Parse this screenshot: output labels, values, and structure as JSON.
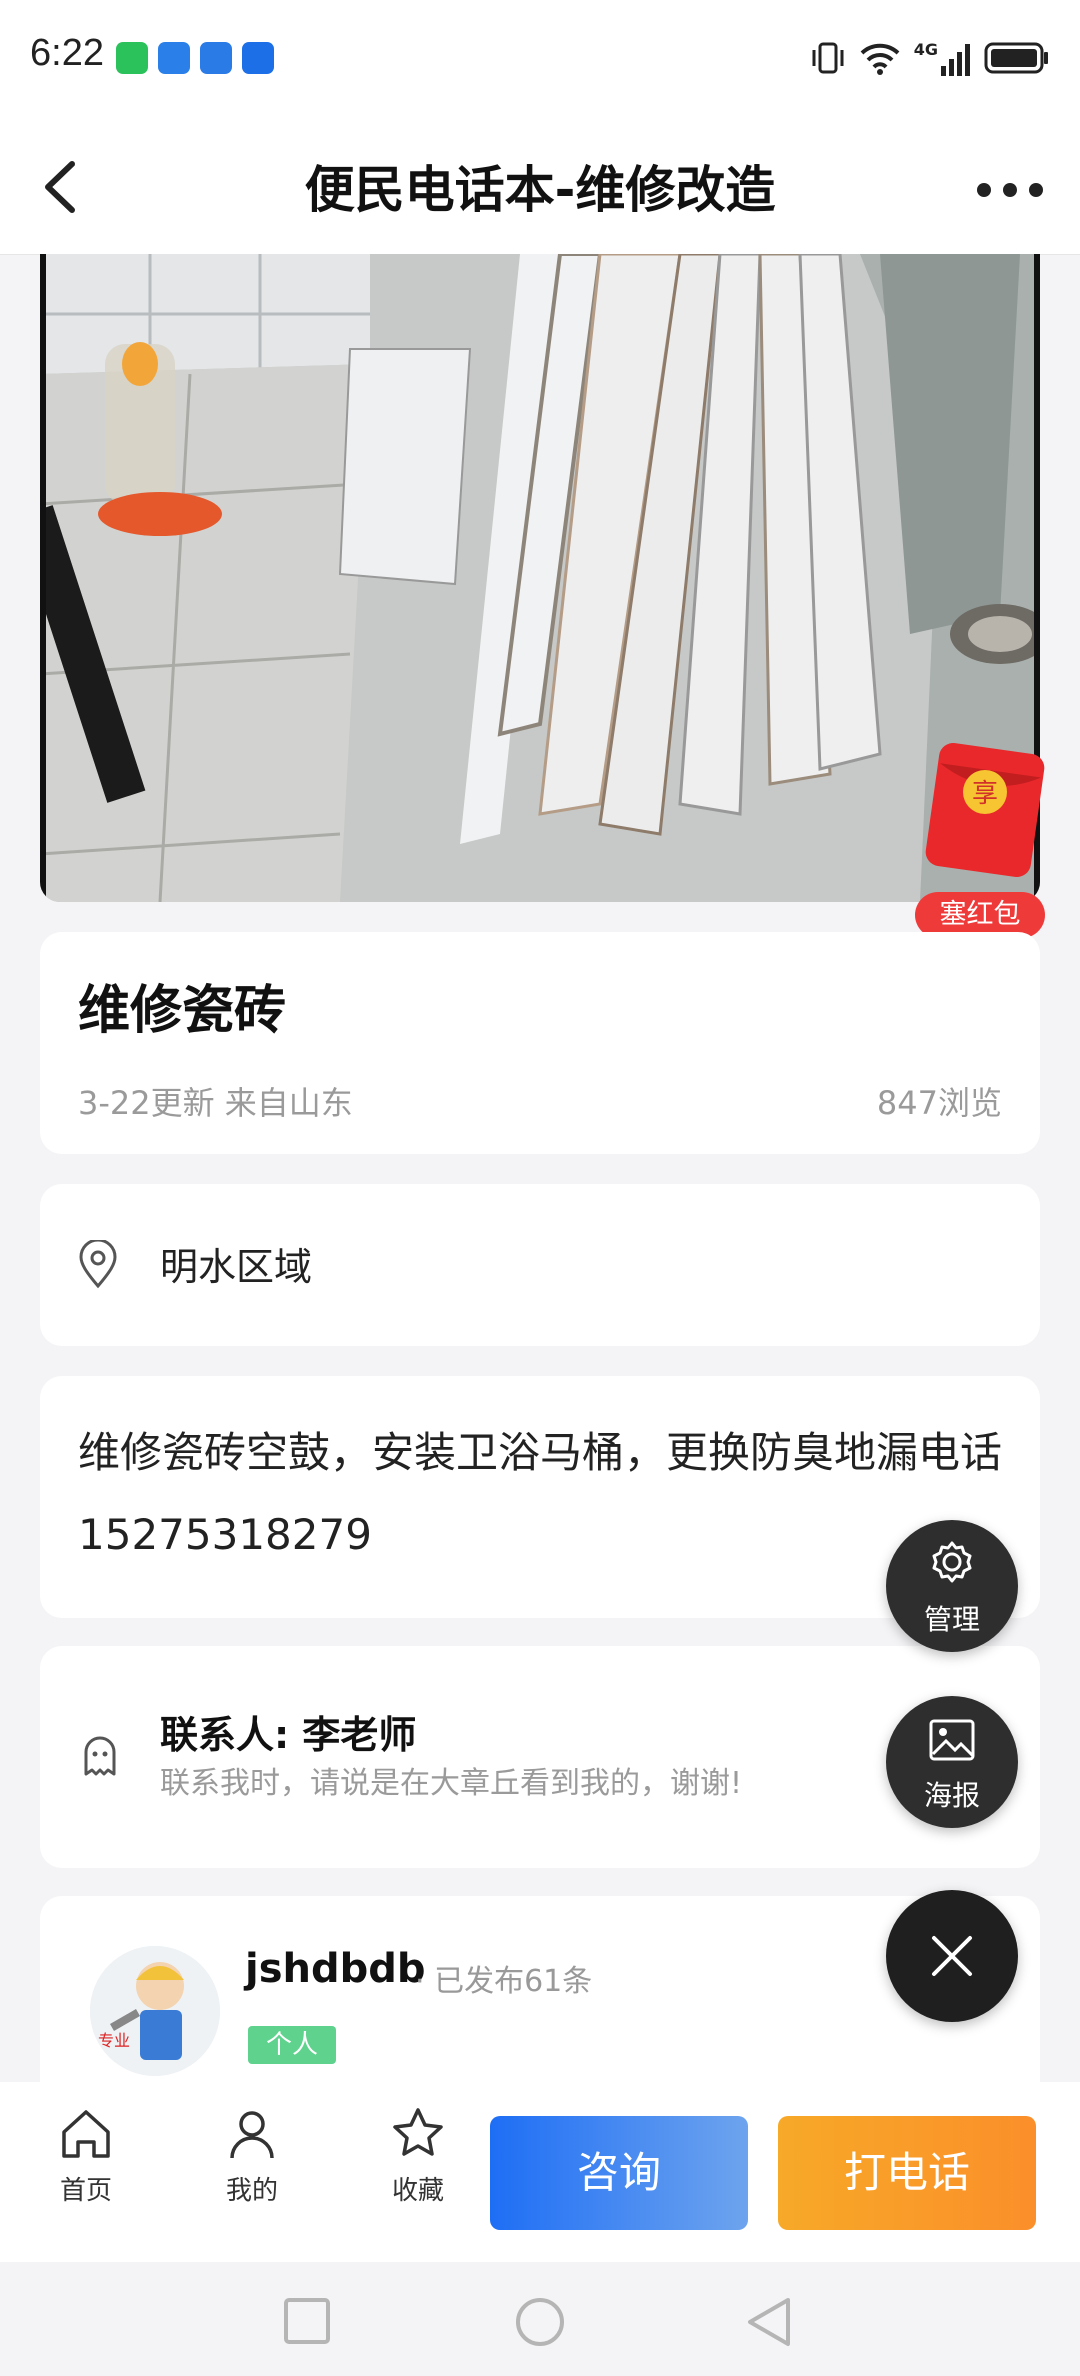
{
  "status_bar": {
    "time": "6:22",
    "notification_icons": [
      "wechat-icon",
      "xianyu-icon",
      "app-icon",
      "dingtalk-icon"
    ],
    "right_icons": [
      "vibrate-icon",
      "wifi-icon",
      "4g-signal-icon",
      "battery-icon"
    ],
    "network_label": "4G"
  },
  "navbar": {
    "title": "便民电话本-维修改造"
  },
  "red_packet": {
    "badge": "享",
    "label": "塞红包"
  },
  "post": {
    "title": "维修瓷砖",
    "meta": "3-22更新 来自山东",
    "views": "847浏览"
  },
  "location": {
    "text": "明水区域"
  },
  "description": {
    "text": "维修瓷砖空鼓，安装卫浴马桶，更换防臭地漏电话15275318279"
  },
  "contact": {
    "name": "联系人: 李老师",
    "tip": "联系我时，请说是在大章丘看到我的，谢谢!"
  },
  "publisher": {
    "username": "jshdbdb",
    "count": "· 已发布61条",
    "tag": "个人",
    "avatar_text": "专业"
  },
  "fabs": {
    "manage_label": "管理",
    "poster_label": "海报"
  },
  "bottom_bar": {
    "tabs": [
      {
        "label": "首页",
        "icon": "home-icon"
      },
      {
        "label": "我的",
        "icon": "user-icon"
      },
      {
        "label": "收藏",
        "icon": "star-icon"
      }
    ],
    "consult_label": "咨询",
    "call_label": "打电话"
  },
  "colors": {
    "consult": "#1e6ef5",
    "call": "#f7a928",
    "red_packet": "#ef3a3a",
    "tag": "#5fd28e"
  }
}
